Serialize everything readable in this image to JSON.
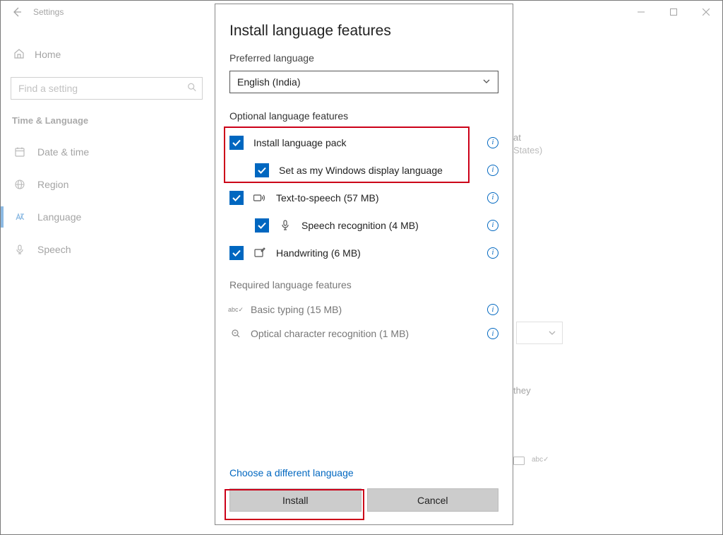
{
  "titlebar": {
    "title": "Settings"
  },
  "sidebar": {
    "home": "Home",
    "search_placeholder": "Find a setting",
    "section": "Time & Language",
    "items": [
      {
        "label": "Date & time"
      },
      {
        "label": "Region"
      },
      {
        "label": "Language"
      },
      {
        "label": "Speech"
      }
    ]
  },
  "background": {
    "lineA": "at",
    "lineB": "States)",
    "lineC": "they"
  },
  "dialog": {
    "title": "Install language features",
    "preferred_label": "Preferred language",
    "preferred_value": "English (India)",
    "optional_label": "Optional language features",
    "features": [
      {
        "label": "Install language pack"
      },
      {
        "label": "Set as my Windows display language"
      },
      {
        "label": "Text-to-speech (57 MB)"
      },
      {
        "label": "Speech recognition (4 MB)"
      },
      {
        "label": "Handwriting (6 MB)"
      }
    ],
    "required_label": "Required language features",
    "required": [
      {
        "label": "Basic typing (15 MB)"
      },
      {
        "label": "Optical character recognition (1 MB)"
      }
    ],
    "choose_link": "Choose a different language",
    "install_btn": "Install",
    "cancel_btn": "Cancel"
  }
}
